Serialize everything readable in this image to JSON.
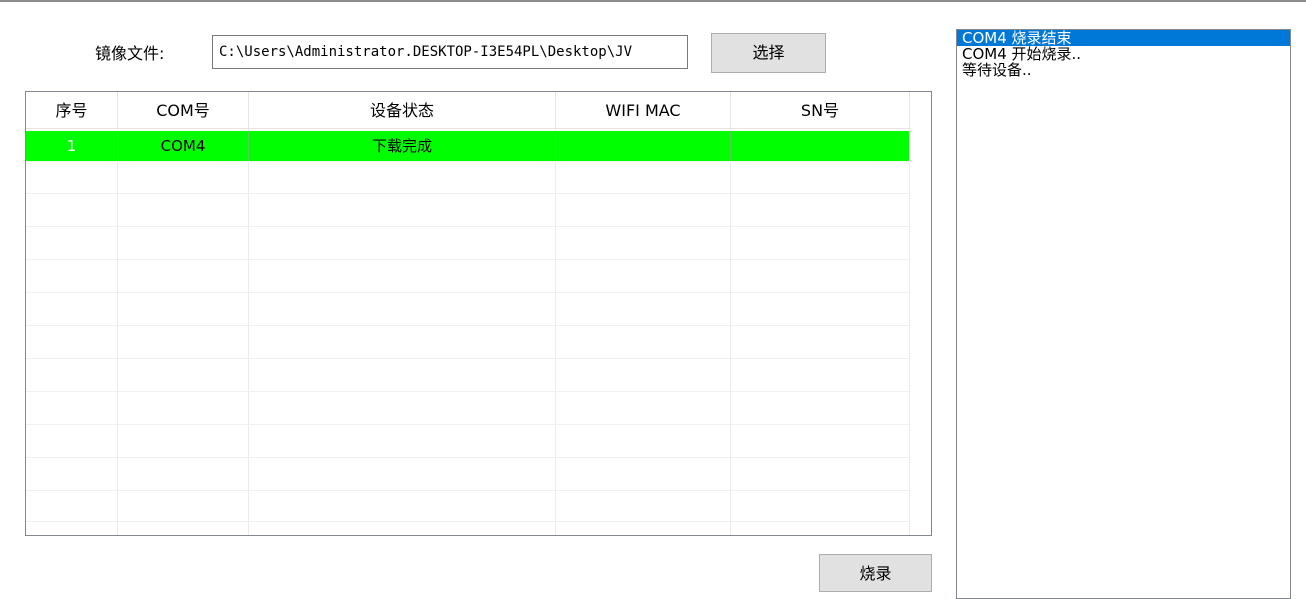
{
  "image_file": {
    "label": "镜像文件:",
    "value": "C:\\Users\\Administrator.DESKTOP-I3E54PL\\Desktop\\JV",
    "select_button": "选择"
  },
  "table": {
    "columns": [
      "序号",
      "COM号",
      "设备状态",
      "WIFI MAC",
      "SN号"
    ],
    "rows": [
      {
        "index": "1",
        "com": "COM4",
        "status": "下载完成",
        "wifi_mac": "",
        "sn": "",
        "row_color": "#00ff00"
      }
    ]
  },
  "burn_button": "烧录",
  "log": {
    "items": [
      "COM4 烧录结束",
      "COM4 开始烧录..",
      "等待设备.."
    ],
    "selected_index": 0,
    "selected_color": "#0078d7"
  }
}
